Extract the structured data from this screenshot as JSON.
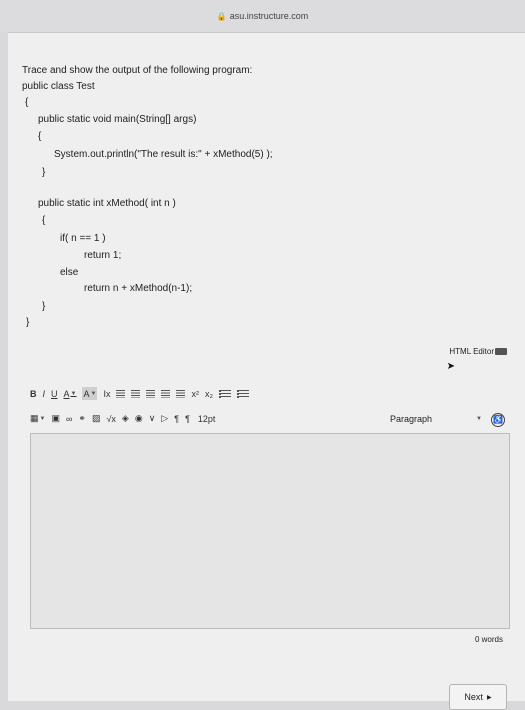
{
  "browser": {
    "url": "asu.instructure.com",
    "lock_glyph": "🔒"
  },
  "question": {
    "lines": [
      "Trace and show the output of the following program:",
      "public class Test",
      "{",
      "public static void main(String[] args)",
      "{",
      "System.out.println(\"The result is:\" + xMethod(5) );",
      "}",
      "public static int xMethod( int n )",
      "{",
      "if( n == 1 )",
      "return 1;",
      "else",
      "return n + xMethod(n-1);",
      "}",
      "}"
    ]
  },
  "editor": {
    "html_editor_link": "HTML Editor",
    "toolbar": {
      "bold": "B",
      "italic": "I",
      "underline": "U",
      "text_color": "A",
      "bg_color": "A",
      "clear_format": "Ix",
      "superscript": "x²",
      "subscript": "x₂",
      "font_size": "12pt",
      "paragraph": "Paragraph",
      "ltr": "¶",
      "rtl": "¶"
    },
    "word_count": "0 words"
  },
  "footer": {
    "next_label": "Next"
  }
}
